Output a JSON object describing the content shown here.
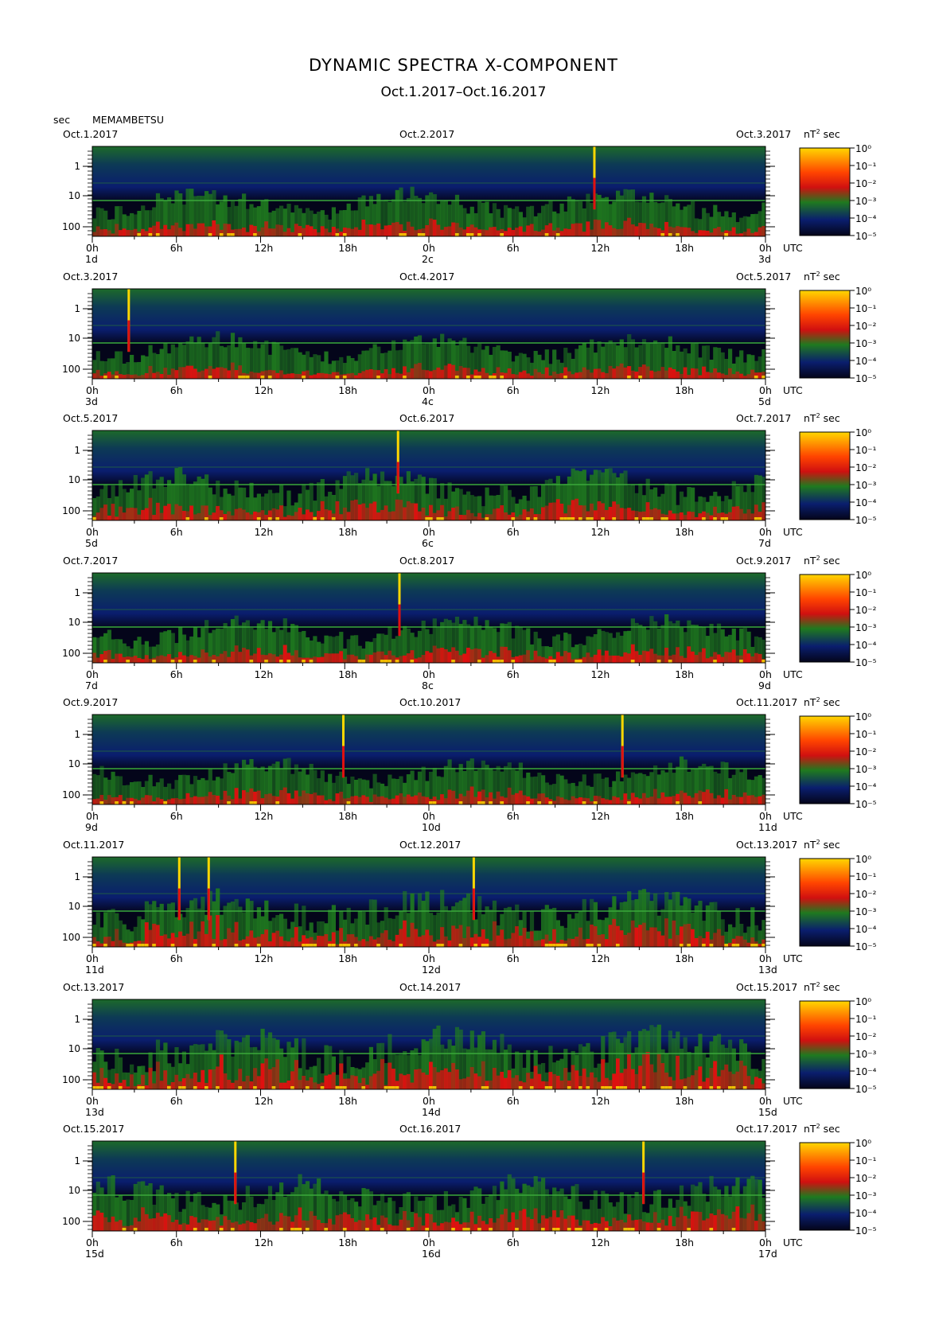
{
  "header": {
    "title": "DYNAMIC SPECTRA X-COMPONENT",
    "subtitle": "Oct.1.2017–Oct.16.2017",
    "y_unit": "sec",
    "station": "MEMAMBETSU",
    "cbar_unit_prefix": "nT",
    "cbar_unit_suffix": "sec",
    "utc_label": "UTC"
  },
  "colors": {
    "background": "#04051a",
    "low": "#0a1e6e",
    "mid": "#1f7a1f",
    "high": "#e01010",
    "peak": "#ffd700"
  },
  "chart_data": {
    "type": "heatmap",
    "title": "DYNAMIC SPECTRA X-COMPONENT",
    "subtitle": "Oct.1.2017–Oct.16.2017",
    "ylabel": "sec",
    "y_scale": "log",
    "y_ticks": [
      "1",
      "10",
      "100"
    ],
    "x_ticks": [
      "0h",
      "6h",
      "12h",
      "18h",
      "0h",
      "6h",
      "12h",
      "18h",
      "0h"
    ],
    "colorbar_ticks": [
      "10⁰",
      "10⁻¹",
      "10⁻²",
      "10⁻³",
      "10⁻⁴",
      "10⁻⁵"
    ],
    "panels": [
      {
        "left_date": "Oct.1.2017",
        "mid_date": "Oct.2.2017",
        "right_date": "Oct.3.2017",
        "day_start": "1d",
        "day_mid": "2c",
        "day_end": "3d",
        "spikes_hours": [
          35.8
        ],
        "activity": 0.45,
        "seed": 11
      },
      {
        "left_date": "Oct.3.2017",
        "mid_date": "Oct.4.2017",
        "right_date": "Oct.5.2017",
        "day_start": "3d",
        "day_mid": "4c",
        "day_end": "5d",
        "spikes_hours": [
          2.6
        ],
        "activity": 0.4,
        "seed": 23
      },
      {
        "left_date": "Oct.5.2017",
        "mid_date": "Oct.6.2017",
        "right_date": "Oct.7.2017",
        "day_start": "5d",
        "day_mid": "6c",
        "day_end": "7d",
        "spikes_hours": [
          21.8
        ],
        "activity": 0.55,
        "seed": 37
      },
      {
        "left_date": "Oct.7.2017",
        "mid_date": "Oct.8.2017",
        "right_date": "Oct.9.2017",
        "day_start": "7d",
        "day_mid": "8c",
        "day_end": "9d",
        "spikes_hours": [
          21.9
        ],
        "activity": 0.45,
        "seed": 41
      },
      {
        "left_date": "Oct.9.2017",
        "mid_date": "Oct.10.2017",
        "right_date": "Oct.11.2017",
        "day_start": "9d",
        "day_mid": "10d",
        "day_end": "11d",
        "spikes_hours": [
          17.9,
          37.8
        ],
        "activity": 0.42,
        "seed": 53
      },
      {
        "left_date": "Oct.11.2017",
        "mid_date": "Oct.12.2017",
        "right_date": "Oct.13.2017",
        "day_start": "11d",
        "day_mid": "12d",
        "day_end": "13d",
        "spikes_hours": [
          6.2,
          8.3,
          27.2
        ],
        "activity": 0.7,
        "seed": 67
      },
      {
        "left_date": "Oct.13.2017",
        "mid_date": "Oct.14.2017",
        "right_date": "Oct.15.2017",
        "day_start": "13d",
        "day_mid": "14d",
        "day_end": "15d",
        "spikes_hours": [],
        "activity": 0.85,
        "seed": 79
      },
      {
        "left_date": "Oct.15.2017",
        "mid_date": "Oct.16.2017",
        "right_date": "Oct.17.2017",
        "day_start": "15d",
        "day_mid": "16d",
        "day_end": "17d",
        "spikes_hours": [
          10.2,
          39.3
        ],
        "activity": 0.65,
        "seed": 83
      }
    ]
  }
}
